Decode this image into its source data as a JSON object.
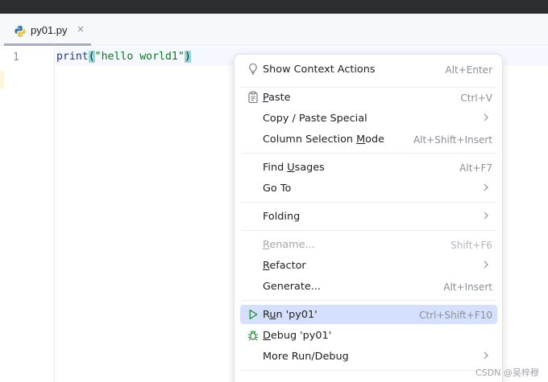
{
  "window": {
    "titlebar_color": "#2b2d30"
  },
  "tab": {
    "label": "py01.py",
    "close_glyph": "×",
    "icon": "python-file-icon"
  },
  "editor": {
    "line_number": "1",
    "code": {
      "fn": "print",
      "open_paren": "(",
      "string": "\"hello world1\"",
      "close_paren": ")"
    }
  },
  "context_menu": {
    "items": [
      {
        "label": "Show Context Actions",
        "shortcut": "Alt+Enter",
        "icon": "lightbulb-icon"
      },
      {
        "pre": "",
        "mnemonic": "P",
        "post": "aste",
        "shortcut": "Ctrl+V",
        "icon": "clipboard-icon"
      },
      {
        "label": "Copy / Paste Special",
        "has_submenu": true
      },
      {
        "pre": "Column Selection ",
        "mnemonic": "M",
        "post": "ode",
        "shortcut": "Alt+Shift+Insert"
      },
      {
        "pre": "Find ",
        "mnemonic": "U",
        "post": "sages",
        "shortcut": "Alt+F7"
      },
      {
        "label": "Go To",
        "has_submenu": true
      },
      {
        "label": "Folding",
        "has_submenu": true
      },
      {
        "pre": "",
        "mnemonic": "R",
        "post": "ename...",
        "shortcut": "Shift+F6",
        "disabled": true
      },
      {
        "pre": "",
        "mnemonic": "R",
        "post": "efactor",
        "has_submenu": true
      },
      {
        "label": "Generate...",
        "shortcut": "Alt+Insert"
      },
      {
        "pre": "R",
        "mnemonic": "u",
        "post": "n 'py01'",
        "shortcut": "Ctrl+Shift+F10",
        "icon": "run-icon",
        "selected": true
      },
      {
        "pre": "",
        "mnemonic": "D",
        "post": "ebug 'py01'",
        "icon": "debug-icon"
      },
      {
        "label": "More Run/Debug",
        "has_submenu": true
      }
    ],
    "selected_color": "#d5e1fc",
    "run_icon_color": "#208a3c"
  },
  "watermark": "CSDN @吴梓穆"
}
